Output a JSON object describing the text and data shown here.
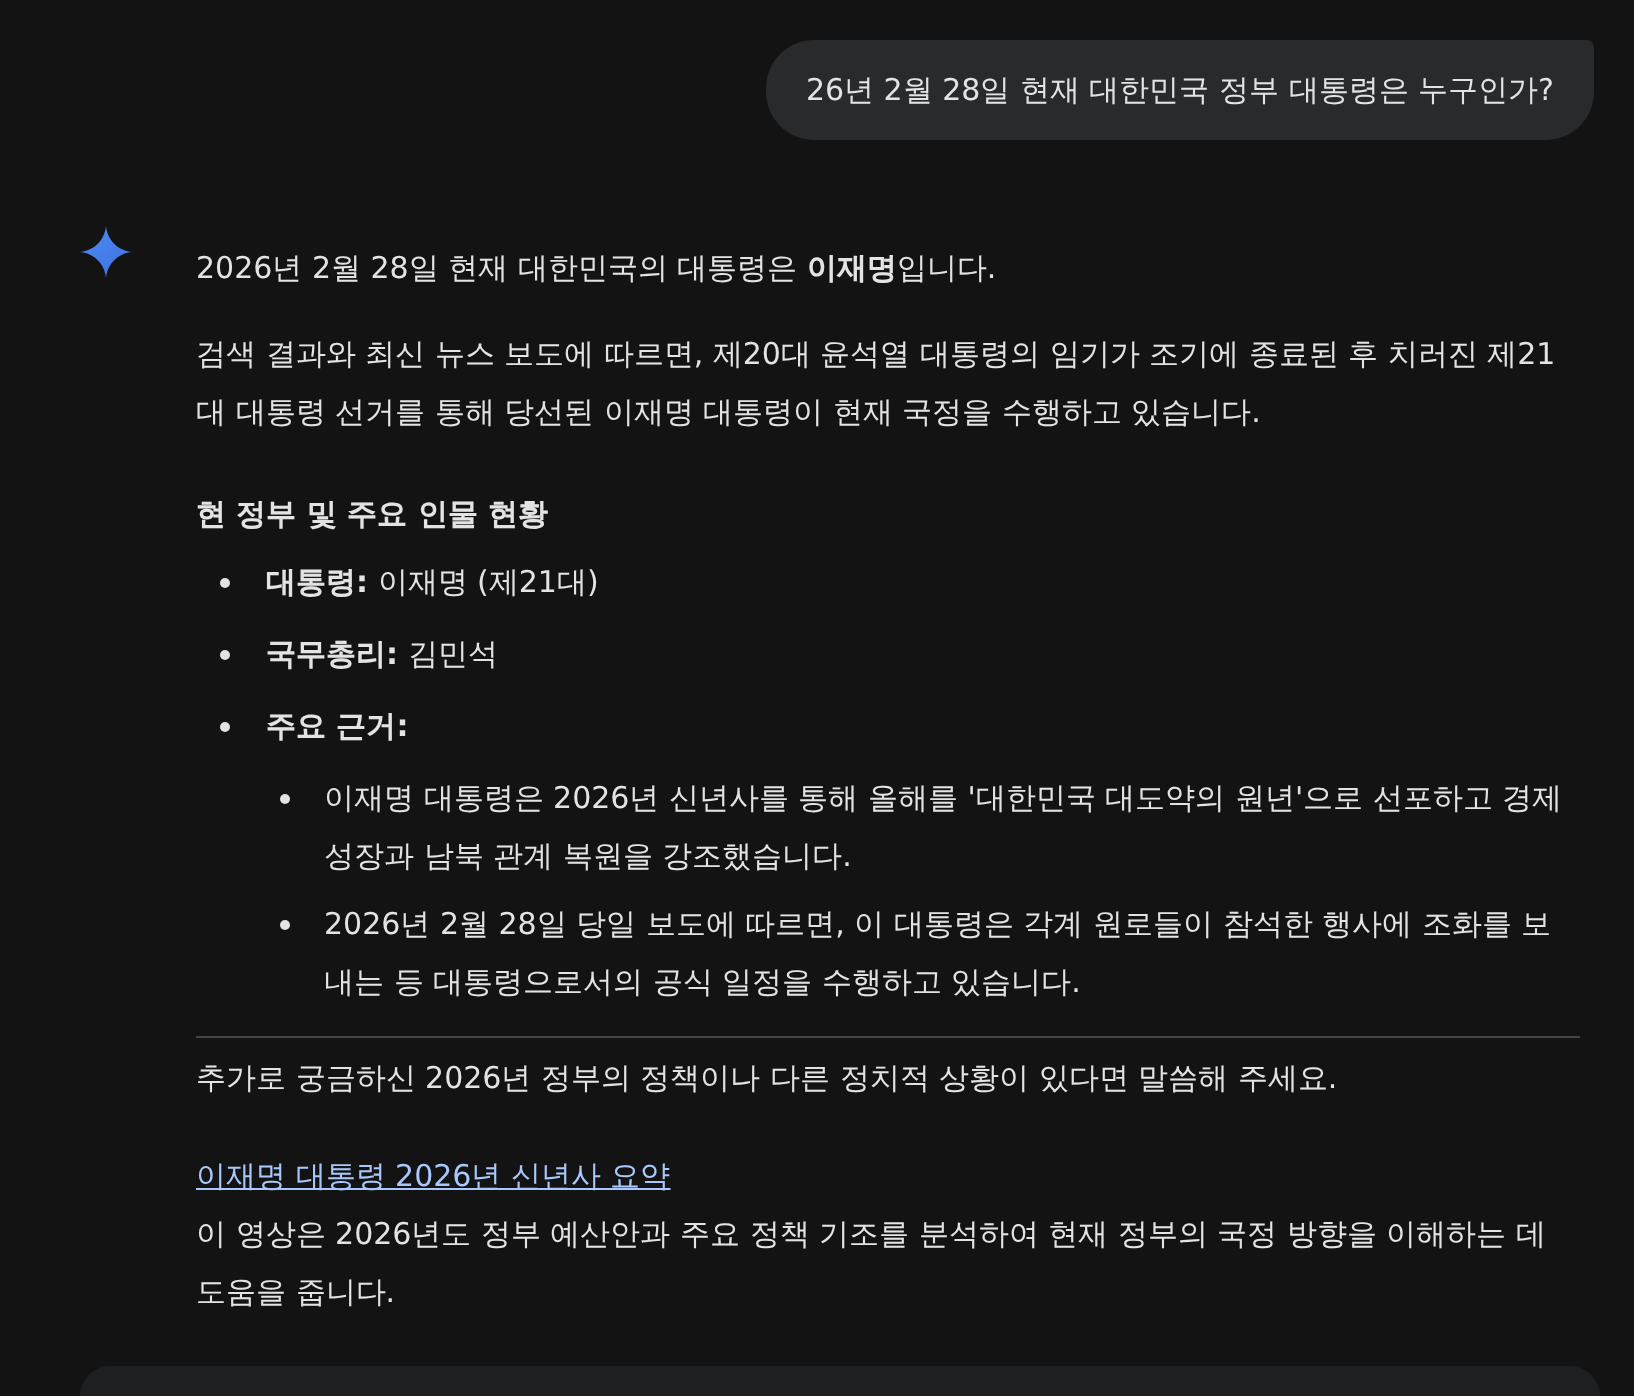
{
  "user_message": {
    "text": "26년 2월 28일 현재 대한민국 정부 대통령은 누구인가?"
  },
  "response": {
    "paragraphs": [
      "2026년 2월 28일 현재 대한민국의 대통령은 **이재명**입니다.",
      "검색 결과와 최신 뉴스 보도에 따르면, 제20대 윤석열 대통령의 임기가 조기에 종료된 후 치러진 제21대 대통령 선거를 통해 당선된 이재명 대통령이 현재 국정을 수행하고 있습니다."
    ],
    "section_heading": "현 정부 및 주요 인물 현황",
    "bullets": [
      {
        "text": "**대통령:** 이재명 (제21대)"
      },
      {
        "text": "**국무총리:** 김민석"
      },
      {
        "text": "**주요 근거:**",
        "children": [
          {
            "text": "이재명 대통령은 2026년 신년사를 통해 올해를 '대한민국 대도약의 원년'으로 선포하고 경제 성장과 남북 관계 복원을 강조했습니다."
          },
          {
            "text": "2026년 2월 28일 당일 보도에 따르면, 이 대통령은 각계 원로들이 참석한 행사에 조화를 보내는 등 대통령으로서의 공식 일정을 수행하고 있습니다."
          }
        ]
      }
    ],
    "closing": "추가로 궁금하신 2026년 정부의 정책이나 다른 정치적 상황이 있다면 말씀해 주세요.",
    "link": {
      "text": "이재명 대통령 2026년 신년사 요약"
    },
    "link_description": "이 영상은 2026년도 정부 예산안과 주요 정책 기조를 분석하여 현재 정부의 국정 방향을 이해하는 데 도움을 줍니다."
  }
}
